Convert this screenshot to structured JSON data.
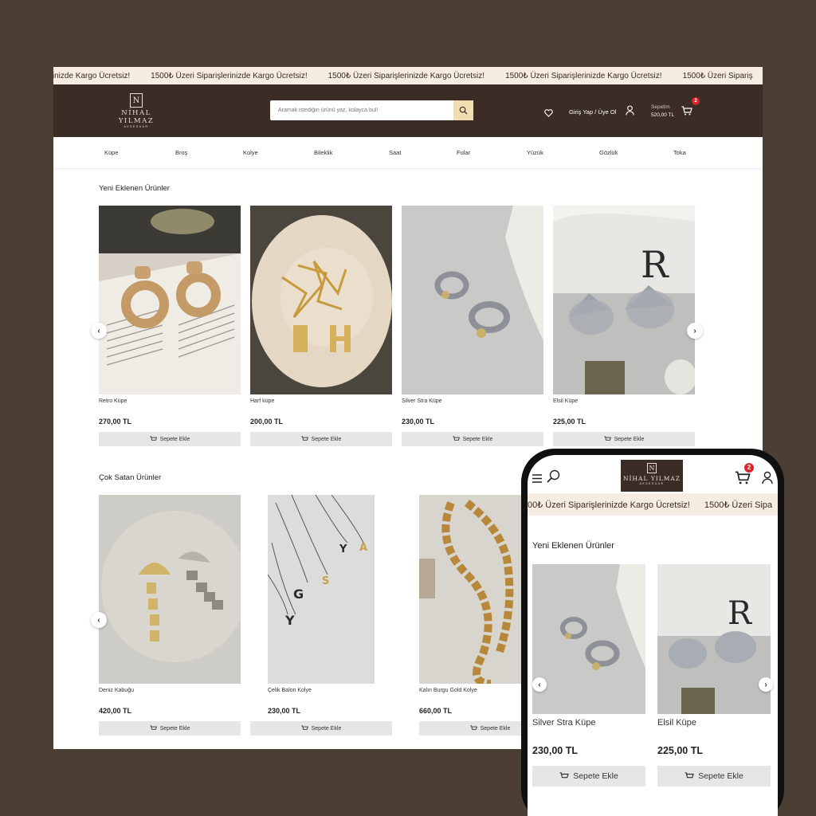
{
  "promo": {
    "first": "erinizde Kargo Ücretsiz!",
    "message": "1500₺ Üzeri Siparişlerinizde Kargo Ücretsiz!",
    "last": "1500₺ Üzeri Sipariş"
  },
  "brand": {
    "name": "NİHAL YILMAZ",
    "subtitle": "AKSESUAR",
    "monogram": "N"
  },
  "header": {
    "search_placeholder": "Aramak istediğin ürünü yaz, kolayca bul!",
    "login_label": "Giriş Yap / Üye Ol",
    "cart_label": "Sepetim",
    "cart_total": "520,00 TL",
    "cart_count": "2"
  },
  "categories": [
    "Küpe",
    "Broş",
    "Kolye",
    "Bileklik",
    "Saat",
    "Fular",
    "Yüzük",
    "Gözlük",
    "Toka"
  ],
  "sections": {
    "new": {
      "title": "Yeni Eklenen Ürünler",
      "products": [
        {
          "name": "Retro Küpe",
          "price": "270,00 TL"
        },
        {
          "name": "Harf küpe",
          "price": "200,00 TL"
        },
        {
          "name": "Silver Stra Küpe",
          "price": "230,00 TL"
        },
        {
          "name": "Elsil Küpe",
          "price": "225,00 TL"
        }
      ]
    },
    "best": {
      "title": "Çok Satan Ürünler",
      "products": [
        {
          "name": "Deniz Kabuğu",
          "price": "420,00 TL"
        },
        {
          "name": "Çelik Balon Kolye",
          "price": "230,00 TL"
        },
        {
          "name": "Kalın Burgu Gold Kolye",
          "price": "660,00 TL"
        }
      ]
    }
  },
  "add_to_cart_label": "Sepete Ekle",
  "mobile": {
    "promo_first": "00₺ Üzeri Siparişlerinizde Kargo Ücretsiz!",
    "promo_second": "1500₺ Üzeri Sipa",
    "section_title": "Yeni Eklenen Ürünler",
    "cart_count": "2",
    "products": [
      {
        "name": "Silver Stra Küpe",
        "price": "230,00 TL"
      },
      {
        "name": "Elsil Küpe",
        "price": "225,00 TL"
      }
    ]
  },
  "colors": {
    "header_bg": "#3b2c26",
    "promo_bg": "#f6ece2",
    "page_bg": "#4b3e33",
    "search_button": "#f1ddb0",
    "badge": "#d8262c"
  }
}
